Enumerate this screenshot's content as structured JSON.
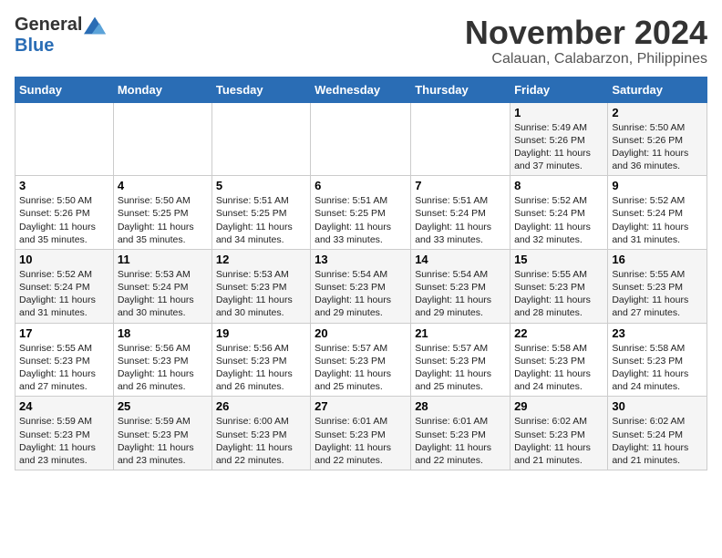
{
  "header": {
    "logo_general": "General",
    "logo_blue": "Blue",
    "month_title": "November 2024",
    "location": "Calauan, Calabarzon, Philippines"
  },
  "weekdays": [
    "Sunday",
    "Monday",
    "Tuesday",
    "Wednesday",
    "Thursday",
    "Friday",
    "Saturday"
  ],
  "weeks": [
    [
      {
        "day": "",
        "info": ""
      },
      {
        "day": "",
        "info": ""
      },
      {
        "day": "",
        "info": ""
      },
      {
        "day": "",
        "info": ""
      },
      {
        "day": "",
        "info": ""
      },
      {
        "day": "1",
        "info": "Sunrise: 5:49 AM\nSunset: 5:26 PM\nDaylight: 11 hours and 37 minutes."
      },
      {
        "day": "2",
        "info": "Sunrise: 5:50 AM\nSunset: 5:26 PM\nDaylight: 11 hours and 36 minutes."
      }
    ],
    [
      {
        "day": "3",
        "info": "Sunrise: 5:50 AM\nSunset: 5:26 PM\nDaylight: 11 hours and 35 minutes."
      },
      {
        "day": "4",
        "info": "Sunrise: 5:50 AM\nSunset: 5:25 PM\nDaylight: 11 hours and 35 minutes."
      },
      {
        "day": "5",
        "info": "Sunrise: 5:51 AM\nSunset: 5:25 PM\nDaylight: 11 hours and 34 minutes."
      },
      {
        "day": "6",
        "info": "Sunrise: 5:51 AM\nSunset: 5:25 PM\nDaylight: 11 hours and 33 minutes."
      },
      {
        "day": "7",
        "info": "Sunrise: 5:51 AM\nSunset: 5:24 PM\nDaylight: 11 hours and 33 minutes."
      },
      {
        "day": "8",
        "info": "Sunrise: 5:52 AM\nSunset: 5:24 PM\nDaylight: 11 hours and 32 minutes."
      },
      {
        "day": "9",
        "info": "Sunrise: 5:52 AM\nSunset: 5:24 PM\nDaylight: 11 hours and 31 minutes."
      }
    ],
    [
      {
        "day": "10",
        "info": "Sunrise: 5:52 AM\nSunset: 5:24 PM\nDaylight: 11 hours and 31 minutes."
      },
      {
        "day": "11",
        "info": "Sunrise: 5:53 AM\nSunset: 5:24 PM\nDaylight: 11 hours and 30 minutes."
      },
      {
        "day": "12",
        "info": "Sunrise: 5:53 AM\nSunset: 5:23 PM\nDaylight: 11 hours and 30 minutes."
      },
      {
        "day": "13",
        "info": "Sunrise: 5:54 AM\nSunset: 5:23 PM\nDaylight: 11 hours and 29 minutes."
      },
      {
        "day": "14",
        "info": "Sunrise: 5:54 AM\nSunset: 5:23 PM\nDaylight: 11 hours and 29 minutes."
      },
      {
        "day": "15",
        "info": "Sunrise: 5:55 AM\nSunset: 5:23 PM\nDaylight: 11 hours and 28 minutes."
      },
      {
        "day": "16",
        "info": "Sunrise: 5:55 AM\nSunset: 5:23 PM\nDaylight: 11 hours and 27 minutes."
      }
    ],
    [
      {
        "day": "17",
        "info": "Sunrise: 5:55 AM\nSunset: 5:23 PM\nDaylight: 11 hours and 27 minutes."
      },
      {
        "day": "18",
        "info": "Sunrise: 5:56 AM\nSunset: 5:23 PM\nDaylight: 11 hours and 26 minutes."
      },
      {
        "day": "19",
        "info": "Sunrise: 5:56 AM\nSunset: 5:23 PM\nDaylight: 11 hours and 26 minutes."
      },
      {
        "day": "20",
        "info": "Sunrise: 5:57 AM\nSunset: 5:23 PM\nDaylight: 11 hours and 25 minutes."
      },
      {
        "day": "21",
        "info": "Sunrise: 5:57 AM\nSunset: 5:23 PM\nDaylight: 11 hours and 25 minutes."
      },
      {
        "day": "22",
        "info": "Sunrise: 5:58 AM\nSunset: 5:23 PM\nDaylight: 11 hours and 24 minutes."
      },
      {
        "day": "23",
        "info": "Sunrise: 5:58 AM\nSunset: 5:23 PM\nDaylight: 11 hours and 24 minutes."
      }
    ],
    [
      {
        "day": "24",
        "info": "Sunrise: 5:59 AM\nSunset: 5:23 PM\nDaylight: 11 hours and 23 minutes."
      },
      {
        "day": "25",
        "info": "Sunrise: 5:59 AM\nSunset: 5:23 PM\nDaylight: 11 hours and 23 minutes."
      },
      {
        "day": "26",
        "info": "Sunrise: 6:00 AM\nSunset: 5:23 PM\nDaylight: 11 hours and 22 minutes."
      },
      {
        "day": "27",
        "info": "Sunrise: 6:01 AM\nSunset: 5:23 PM\nDaylight: 11 hours and 22 minutes."
      },
      {
        "day": "28",
        "info": "Sunrise: 6:01 AM\nSunset: 5:23 PM\nDaylight: 11 hours and 22 minutes."
      },
      {
        "day": "29",
        "info": "Sunrise: 6:02 AM\nSunset: 5:23 PM\nDaylight: 11 hours and 21 minutes."
      },
      {
        "day": "30",
        "info": "Sunrise: 6:02 AM\nSunset: 5:24 PM\nDaylight: 11 hours and 21 minutes."
      }
    ]
  ]
}
